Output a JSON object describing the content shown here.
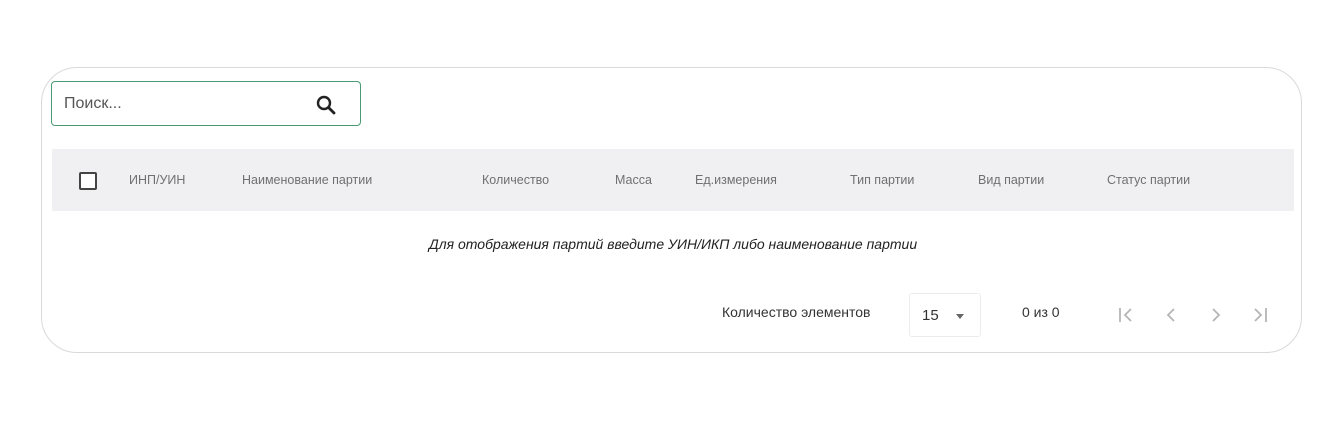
{
  "search": {
    "placeholder": "Поиск..."
  },
  "table": {
    "columns": [
      "ИНП/УИН",
      "Наименование партии",
      "Количество",
      "Масса",
      "Ед.измерения",
      "Тип партии",
      "Вид партии",
      "Статус партии"
    ],
    "empty_message": "Для отображения партий введите УИН/ИКП либо наименование партии"
  },
  "pagination": {
    "page_size_label": "Количество элементов",
    "page_size_value": "15",
    "range_text": "0 из 0"
  },
  "icons": {
    "search": "search-icon",
    "first": "first-page-icon",
    "prev": "prev-page-icon",
    "next": "next-page-icon",
    "last": "last-page-icon"
  },
  "colors": {
    "search_border": "#4a9a73",
    "header_bg": "#f0eff2",
    "disabled_nav": "#b5b5b5"
  }
}
